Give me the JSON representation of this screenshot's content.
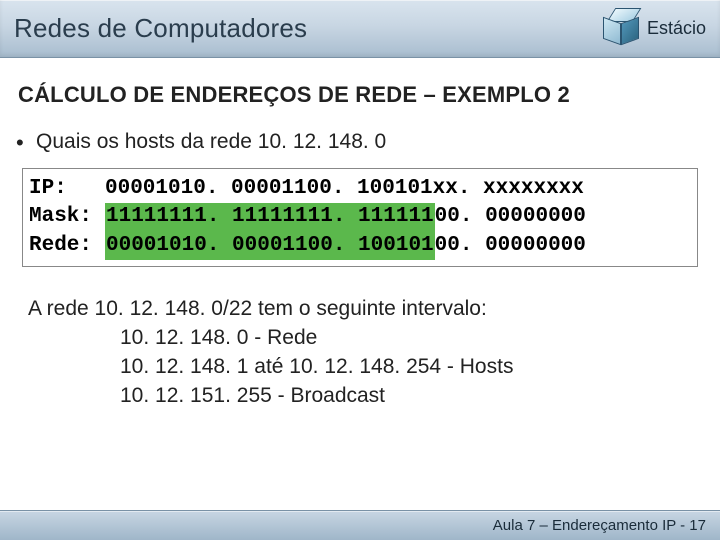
{
  "header": {
    "title": "Redes de Computadores",
    "brand": "Estácio"
  },
  "section_title": "CÁLCULO DE ENDEREÇOS DE REDE – EXEMPLO 2",
  "bullet": "Quais os hosts da rede 10. 12. 148. 0",
  "mono": {
    "ip_label": "IP:",
    "ip_value": "00001010. 00001100. 100101xx. xxxxxxxx",
    "mask_label": "Mask:",
    "mask_prefix": "11111111. 11111111. 111111",
    "mask_suffix": "00. 00000000",
    "rede_label": "Rede:",
    "rede_prefix": "00001010. 00001100. 100101",
    "rede_suffix": "00. 00000000"
  },
  "paragraph": {
    "line1": "A rede 10. 12. 148. 0/22 tem o seguinte intervalo:",
    "line2": "10. 12. 148. 0 - Rede",
    "line3": "10. 12. 148. 1 até 10. 12. 148. 254 - Hosts",
    "line4": "10. 12. 151. 255 - Broadcast"
  },
  "footer": "Aula 7 – Endereçamento IP  - 17"
}
